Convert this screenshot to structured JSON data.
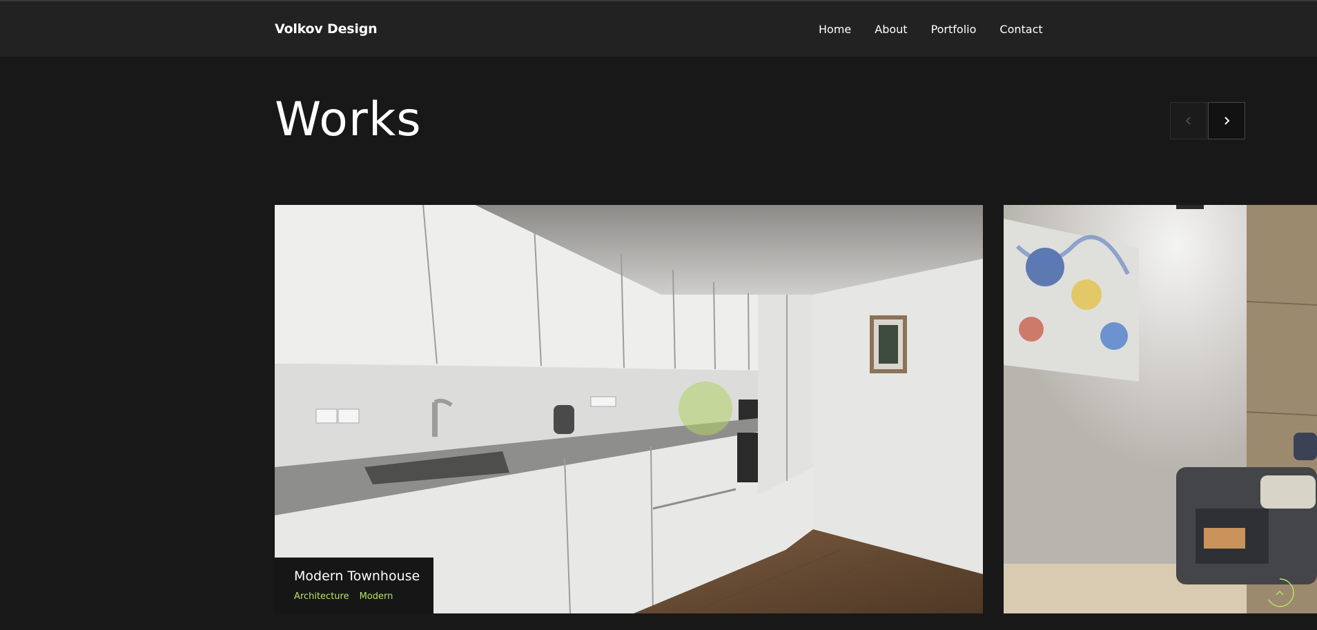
{
  "header": {
    "logo": "Volkov Design",
    "nav": [
      "Home",
      "About",
      "Portfolio",
      "Contact"
    ]
  },
  "works": {
    "title": "Works",
    "prev_icon": "chevron-left-icon",
    "next_icon": "chevron-right-icon",
    "cards": [
      {
        "title": "Modern Townhouse",
        "tags": [
          "Architecture",
          "Modern"
        ],
        "image": "kitchen-photo"
      },
      {
        "image": "living-room-photo"
      }
    ]
  },
  "scroll_top_icon": "chevron-up-icon",
  "colors": {
    "background": "#181818",
    "header": "#222222",
    "accent": "#b8e26b"
  }
}
